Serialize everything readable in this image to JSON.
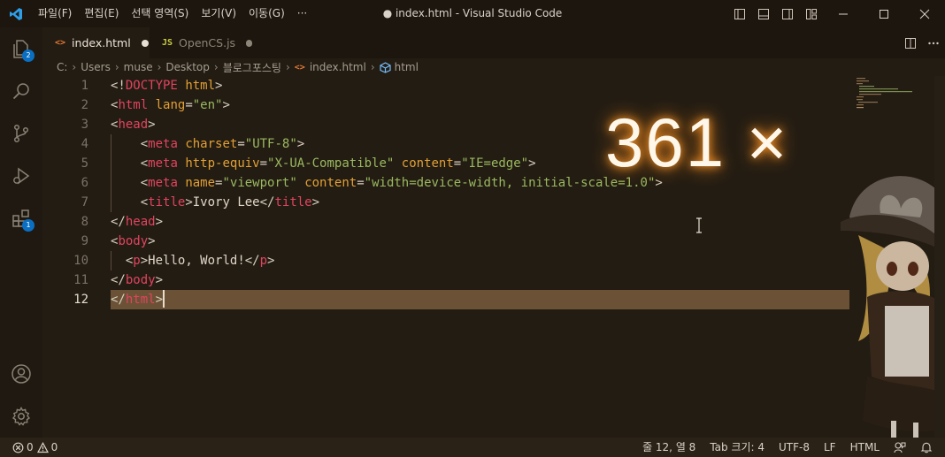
{
  "titlebar": {
    "menu": [
      "파일(F)",
      "편집(E)",
      "선택 영역(S)",
      "보기(V)",
      "이동(G)",
      "···"
    ],
    "window_title": "● index.html - Visual Studio Code"
  },
  "activitybar": {
    "items": [
      {
        "icon": "explorer-icon",
        "badge": "2"
      },
      {
        "icon": "search-icon"
      },
      {
        "icon": "source-control-icon"
      },
      {
        "icon": "run-debug-icon"
      },
      {
        "icon": "extensions-icon",
        "badge": "1"
      }
    ],
    "bottom": [
      {
        "icon": "account-icon"
      },
      {
        "icon": "gear-icon"
      }
    ]
  },
  "tabs": [
    {
      "label": "index.html",
      "icon_text": "<>",
      "icon_color": "#e37933",
      "active": true,
      "modified": true
    },
    {
      "label": "OpenCS.js",
      "icon_text": "JS",
      "icon_color": "#cbcb41",
      "active": false,
      "modified": true
    }
  ],
  "breadcrumb": [
    "C:",
    "Users",
    "muse",
    "Desktop",
    "블로그포스팅",
    "index.html",
    "html"
  ],
  "editor": {
    "line_numbers": [
      "1",
      "2",
      "3",
      "4",
      "5",
      "6",
      "7",
      "8",
      "9",
      "10",
      "11",
      "12"
    ],
    "active_line": "12",
    "overlay_text": "361 ×"
  },
  "statusbar": {
    "errors": "0",
    "warnings": "0",
    "position": "줄 12, 열 8",
    "tab_size": "Tab 크기: 4",
    "encoding": "UTF-8",
    "eol": "LF",
    "language": "HTML"
  },
  "colors": {
    "accent_badge": "#0a6fc2",
    "tag": "#e0445e",
    "attribute": "#e2a034",
    "string": "#9ab95f",
    "line_highlight": "#6b5236"
  }
}
